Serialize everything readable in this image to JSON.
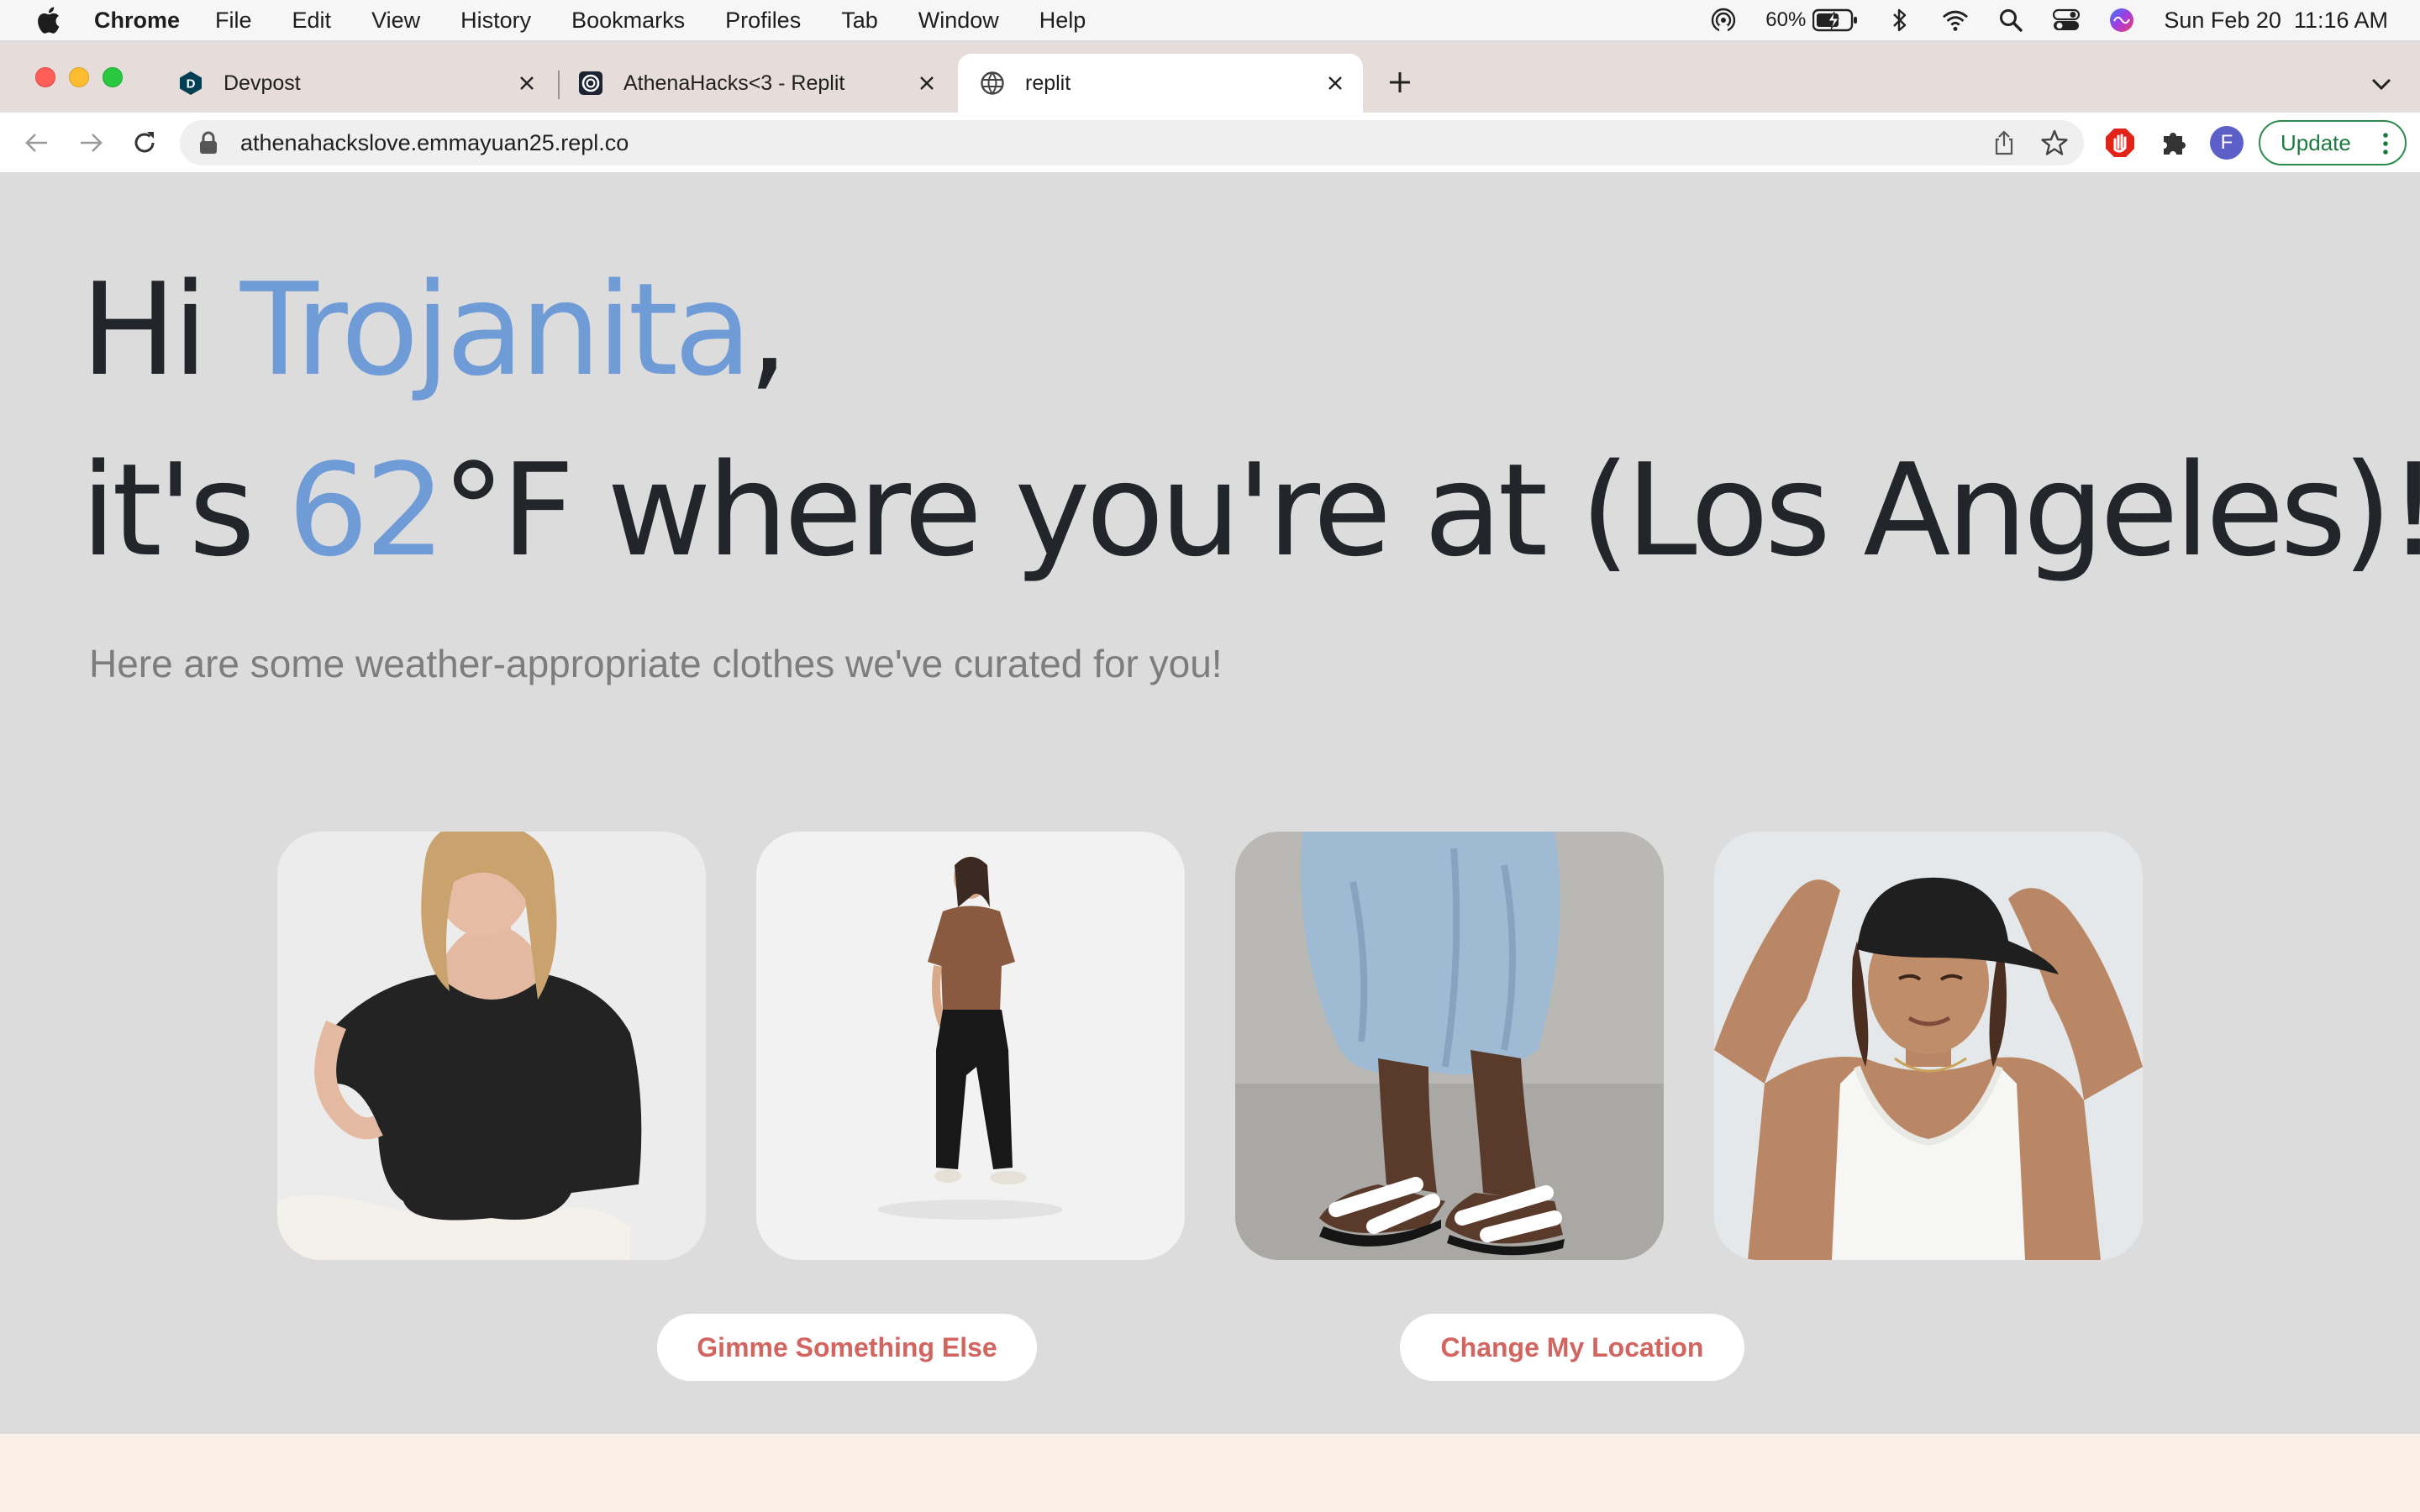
{
  "menubar": {
    "app_name": "Chrome",
    "items": [
      "File",
      "Edit",
      "View",
      "History",
      "Bookmarks",
      "Profiles",
      "Tab",
      "Window",
      "Help"
    ],
    "battery_percent": "60%",
    "datetime": "Sun Feb 20  11:16 AM"
  },
  "tabs": [
    {
      "title": "Devpost",
      "favicon": "devpost-icon"
    },
    {
      "title": "AthenaHacks<3 - Replit",
      "favicon": "replit-icon"
    },
    {
      "title": "replit",
      "favicon": "globe-icon",
      "active": true
    }
  ],
  "toolbar": {
    "url": "athenahackslove.emmayuan25.repl.co",
    "profile_initial": "F",
    "update_label": "Update"
  },
  "page": {
    "greeting_prefix": "Hi ",
    "user_name": "Trojanita",
    "greeting_suffix": ",",
    "temp_prefix": "it's ",
    "temperature": "62",
    "temp_suffix": "°F where you're at (Los Angeles)!",
    "subtitle": "Here are some weather-appropriate clothes we've curated for you!",
    "buttons": {
      "shuffle_label": "Gimme Something Else",
      "location_label": "Change My Location"
    }
  },
  "colors": {
    "accent_blue": "#6f9bd6",
    "button_text": "#d2655f",
    "page_bg": "#dcdcdc"
  }
}
